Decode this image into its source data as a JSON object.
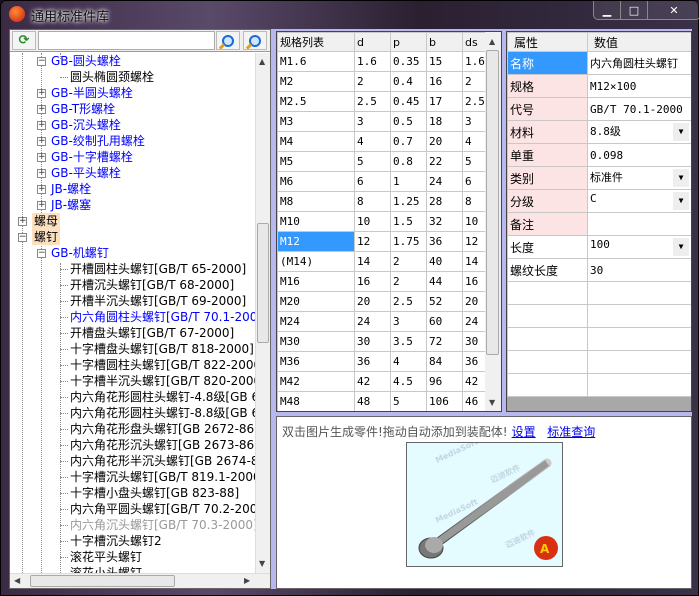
{
  "window": {
    "title": "通用标准件库",
    "controls": [
      "minimize",
      "maximize",
      "close"
    ]
  },
  "toolbar": {
    "search_value": "",
    "refresh_icon": "refresh-icon",
    "search_icons": [
      "search-icon",
      "search-next-icon"
    ]
  },
  "tree": [
    {
      "label": "GB-圆头螺栓",
      "level": 2,
      "expander": "minus",
      "color": "blue"
    },
    {
      "label": "圆头椭圆颈螺栓",
      "level": 3,
      "expander": "",
      "color": "black"
    },
    {
      "label": "GB-半圆头螺栓",
      "level": 2,
      "expander": "plus",
      "color": "blue"
    },
    {
      "label": "GB-T形螺栓",
      "level": 2,
      "expander": "plus",
      "color": "blue"
    },
    {
      "label": "GB-沉头螺栓",
      "level": 2,
      "expander": "plus",
      "color": "blue"
    },
    {
      "label": "GB-绞制孔用螺栓",
      "level": 2,
      "expander": "plus",
      "color": "blue"
    },
    {
      "label": "GB-十字槽螺栓",
      "level": 2,
      "expander": "plus",
      "color": "blue"
    },
    {
      "label": "GB-平头螺栓",
      "level": 2,
      "expander": "plus",
      "color": "blue"
    },
    {
      "label": "JB-螺栓",
      "level": 2,
      "expander": "plus",
      "color": "blue"
    },
    {
      "label": "JB-螺塞",
      "level": 2,
      "expander": "plus",
      "color": "blue"
    },
    {
      "label": "螺母",
      "level": 1,
      "expander": "plus",
      "color": "black",
      "highlight": true
    },
    {
      "label": "螺钉",
      "level": 1,
      "expander": "minus",
      "color": "black",
      "highlight": true
    },
    {
      "label": "GB-机螺钉",
      "level": 2,
      "expander": "minus",
      "color": "blue"
    },
    {
      "label": "开槽圆柱头螺钉[GB/T 65-2000]",
      "level": 3,
      "color": "black"
    },
    {
      "label": "开槽沉头螺钉[GB/T 68-2000]",
      "level": 3,
      "color": "black"
    },
    {
      "label": "开槽半沉头螺钉[GB/T 69-2000]",
      "level": 3,
      "color": "black"
    },
    {
      "label": "内六角圆柱头螺钉[GB/T 70.1-2000]",
      "level": 3,
      "color": "blue"
    },
    {
      "label": "开槽盘头螺钉[GB/T 67-2000]",
      "level": 3,
      "color": "black"
    },
    {
      "label": "十字槽盘头螺钉[GB/T 818-2000]",
      "level": 3,
      "color": "black"
    },
    {
      "label": "十字槽圆柱头螺钉[GB/T 822-2000]",
      "level": 3,
      "color": "black"
    },
    {
      "label": "十字槽半沉头螺钉[GB/T 820-2000]",
      "level": 3,
      "color": "black"
    },
    {
      "label": "内六角花形圆柱头螺钉-4.8级[GB 6",
      "level": 3,
      "color": "black"
    },
    {
      "label": "内六角花形圆柱头螺钉-8.8级[GB 6",
      "level": 3,
      "color": "black"
    },
    {
      "label": "内六角花形盘头螺钉[GB 2672-86]",
      "level": 3,
      "color": "black"
    },
    {
      "label": "内六角花形沉头螺钉[GB 2673-86]",
      "level": 3,
      "color": "black"
    },
    {
      "label": "内六角花形半沉头螺钉[GB 2674-86",
      "level": 3,
      "color": "black"
    },
    {
      "label": "十字槽沉头螺钉[GB/T 819.1-2000",
      "level": 3,
      "color": "black"
    },
    {
      "label": "十字槽小盘头螺钉[GB 823-88]",
      "level": 3,
      "color": "black"
    },
    {
      "label": "内六角平圆头螺钉[GB/T 70.2-2000",
      "level": 3,
      "color": "black"
    },
    {
      "label": "内六角沉头螺钉[GB/T 70.3-2000]",
      "level": 3,
      "color": "gray"
    },
    {
      "label": "十字槽沉头螺钉2",
      "level": 3,
      "color": "black"
    },
    {
      "label": "滚花平头螺钉",
      "level": 3,
      "color": "black"
    },
    {
      "label": "滚花小头螺钉",
      "level": 3,
      "color": "black"
    }
  ],
  "specs": {
    "headers": [
      "规格列表",
      "d",
      "p",
      "b",
      "ds"
    ],
    "selected_row": 9,
    "rows": [
      [
        "M1.6",
        "1.6",
        "0.35",
        "15",
        "1.6"
      ],
      [
        "M2",
        "2",
        "0.4",
        "16",
        "2"
      ],
      [
        "M2.5",
        "2.5",
        "0.45",
        "17",
        "2.5"
      ],
      [
        "M3",
        "3",
        "0.5",
        "18",
        "3"
      ],
      [
        "M4",
        "4",
        "0.7",
        "20",
        "4"
      ],
      [
        "M5",
        "5",
        "0.8",
        "22",
        "5"
      ],
      [
        "M6",
        "6",
        "1",
        "24",
        "6"
      ],
      [
        "M8",
        "8",
        "1.25",
        "28",
        "8"
      ],
      [
        "M10",
        "10",
        "1.5",
        "32",
        "10"
      ],
      [
        "M12",
        "12",
        "1.75",
        "36",
        "12"
      ],
      [
        "(M14)",
        "14",
        "2",
        "40",
        "14"
      ],
      [
        "M16",
        "16",
        "2",
        "44",
        "16"
      ],
      [
        "M20",
        "20",
        "2.5",
        "52",
        "20"
      ],
      [
        "M24",
        "24",
        "3",
        "60",
        "24"
      ],
      [
        "M30",
        "30",
        "3.5",
        "72",
        "30"
      ],
      [
        "M36",
        "36",
        "4",
        "84",
        "36"
      ],
      [
        "M42",
        "42",
        "4.5",
        "96",
        "42"
      ],
      [
        "M48",
        "48",
        "5",
        "106",
        "46"
      ]
    ]
  },
  "properties": {
    "headers": [
      "属性",
      "数值"
    ],
    "rows": [
      {
        "key": "名称",
        "value": "内六角圆柱头螺钉",
        "style": "selected"
      },
      {
        "key": "规格",
        "value": "M12×100",
        "style": "pink"
      },
      {
        "key": "代号",
        "value": "GB/T 70.1-2000",
        "style": "pink"
      },
      {
        "key": "材料",
        "value": "8.8级",
        "style": "pink",
        "dropdown": true
      },
      {
        "key": "单重",
        "value": "0.098",
        "style": "pink"
      },
      {
        "key": "类别",
        "value": "标准件",
        "style": "pink",
        "dropdown": true
      },
      {
        "key": "分级",
        "value": "C",
        "style": "pink",
        "dropdown": true
      },
      {
        "key": "备注",
        "value": "",
        "style": "pink"
      },
      {
        "key": "长度",
        "value": "100",
        "style": "",
        "dropdown": true
      },
      {
        "key": "螺纹长度",
        "value": "30",
        "style": ""
      },
      {
        "key": "",
        "value": "",
        "style": ""
      },
      {
        "key": "",
        "value": "",
        "style": ""
      },
      {
        "key": "",
        "value": "",
        "style": ""
      },
      {
        "key": "",
        "value": "",
        "style": ""
      },
      {
        "key": "",
        "value": "",
        "style": ""
      }
    ]
  },
  "preview": {
    "hint": "双击图片生成零件!拖动自动添加到装配体!",
    "settings_link": "设置",
    "standard_query_link": "标准查询",
    "watermark": [
      "MediaSoft",
      "迈迪软件"
    ]
  },
  "colors": {
    "selection": "#3399ff",
    "link": "#0000ee",
    "tree_blue": "#0000ff",
    "pink": "#fde4e4",
    "client_bg": "#b8b8f0"
  }
}
